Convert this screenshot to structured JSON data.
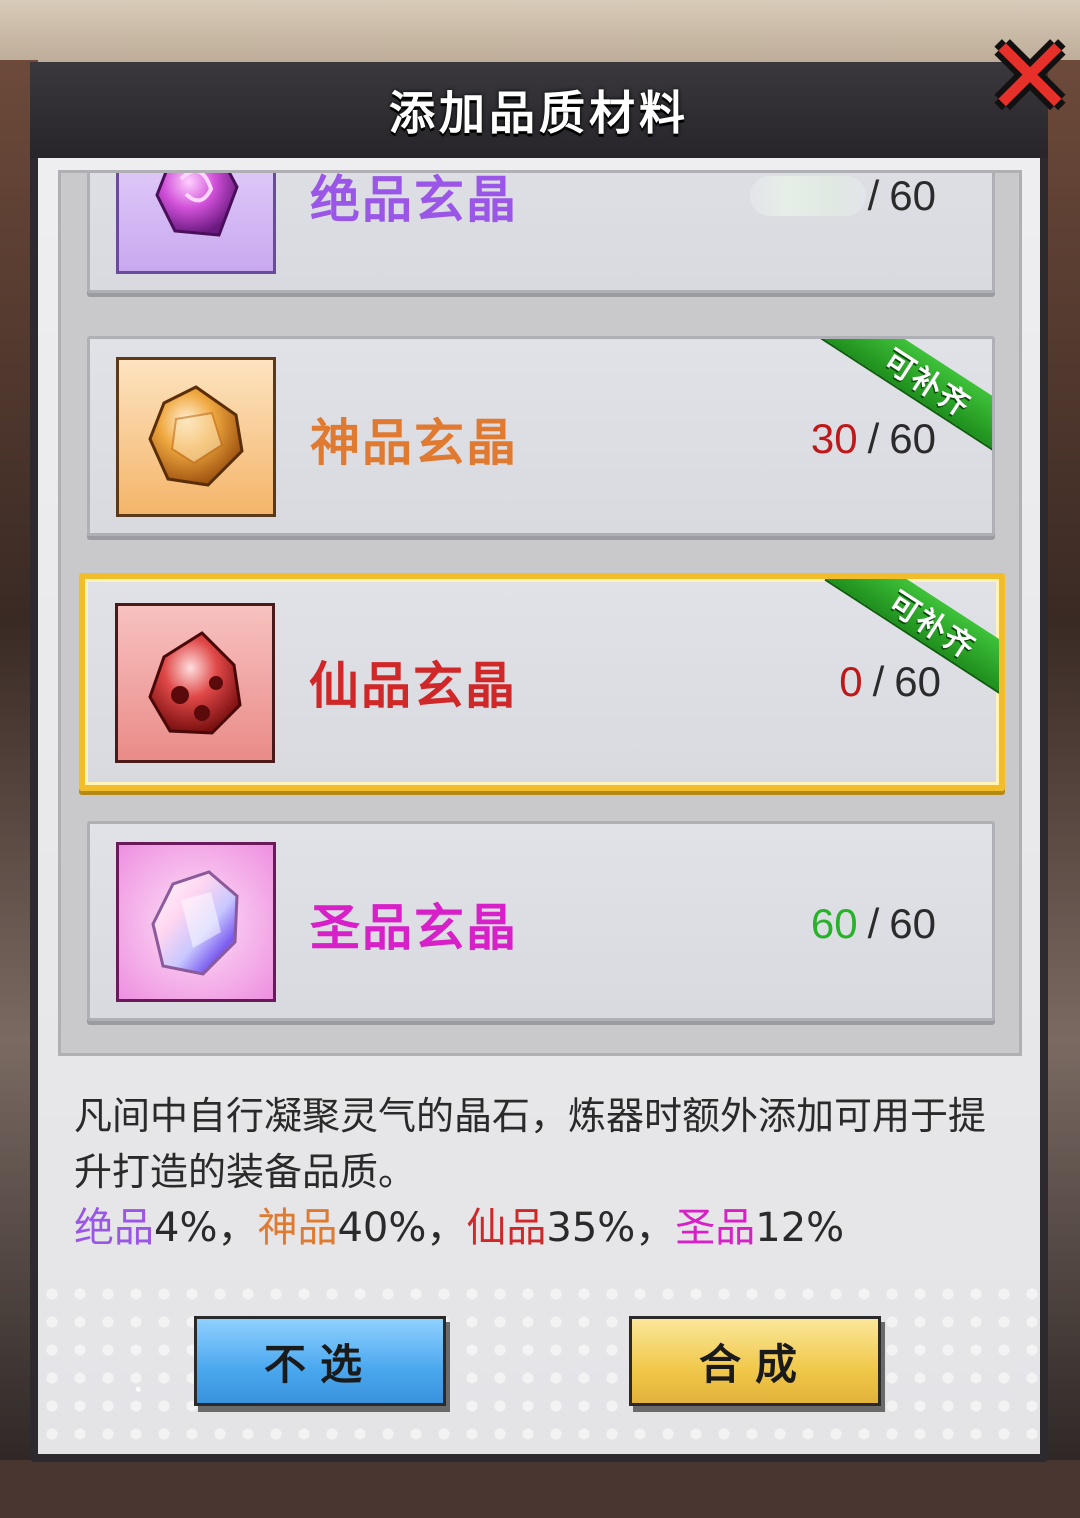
{
  "dialog": {
    "title": "添加品质材料",
    "close_icon": "close-x-icon"
  },
  "materials": [
    {
      "name": "绝品玄晶",
      "current": "",
      "separator": "/",
      "max": "60",
      "color": "#9a56e6",
      "icon": "purple-crystal-icon",
      "refillable": false
    },
    {
      "name": "神品玄晶",
      "current": "30",
      "separator": "/",
      "max": "60",
      "color": "#e07a30",
      "icon": "amber-crystal-icon",
      "refillable": true,
      "ribbon": "可补齐"
    },
    {
      "name": "仙品玄晶",
      "current": "0",
      "separator": "/",
      "max": "60",
      "color": "#d02828",
      "icon": "red-crystal-icon",
      "refillable": true,
      "ribbon": "可补齐",
      "selected": true
    },
    {
      "name": "圣品玄晶",
      "current": "60",
      "separator": "/",
      "max": "60",
      "color": "#d820c8",
      "icon": "rainbow-crystal-icon",
      "refillable": false
    }
  ],
  "description": {
    "text": "凡间中自行凝聚灵气的晶石，炼器时额外添加可用于提升打造的装备品质。",
    "rates": [
      {
        "label": "绝品",
        "value": "4%，"
      },
      {
        "label": "神品",
        "value": "40%，"
      },
      {
        "label": "仙品",
        "value": "35%，"
      },
      {
        "label": "圣品",
        "value": "12%"
      }
    ]
  },
  "buttons": {
    "cancel_label": "不选",
    "confirm_label": "合成"
  }
}
